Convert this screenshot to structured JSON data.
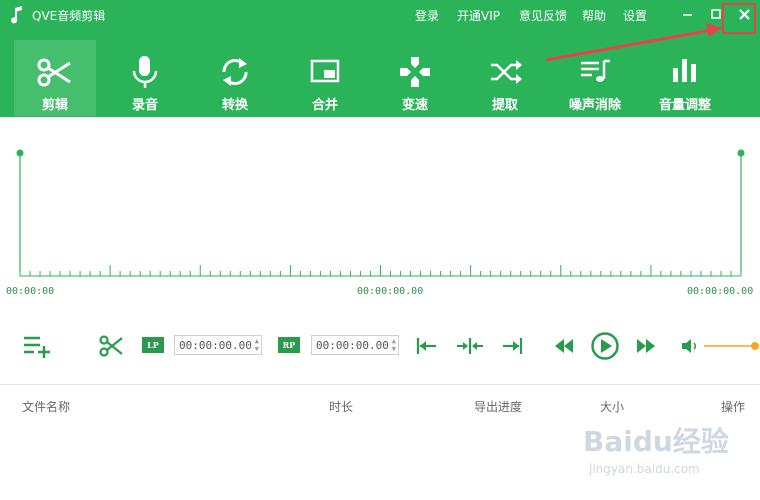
{
  "app": {
    "title": "QVE音频剪辑"
  },
  "menu": {
    "login": "登录",
    "vip": "开通VIP",
    "feedback": "意见反馈",
    "help": "帮助",
    "settings": "设置"
  },
  "tools": [
    {
      "label": "剪辑",
      "icon": "scissors-icon",
      "active": true
    },
    {
      "label": "录音",
      "icon": "microphone-icon",
      "active": false
    },
    {
      "label": "转换",
      "icon": "convert-icon",
      "active": false
    },
    {
      "label": "合并",
      "icon": "merge-icon",
      "active": false
    },
    {
      "label": "变速",
      "icon": "speed-icon",
      "active": false
    },
    {
      "label": "提取",
      "icon": "shuffle-icon",
      "active": false
    },
    {
      "label": "噪声消除",
      "icon": "noise-reduction-icon",
      "active": false
    },
    {
      "label": "音量调整",
      "icon": "volume-bars-icon",
      "active": false
    }
  ],
  "timeline": {
    "start": "00:00:00",
    "middle": "00:00:00.00",
    "end": "00:00:00.00"
  },
  "controls": {
    "lp_label": "LP",
    "rp_label": "RP",
    "lp_time": "00:00:00.00",
    "rp_time": "00:00:00.00"
  },
  "table": {
    "columns": [
      "文件名称",
      "时长",
      "导出进度",
      "大小",
      "操作"
    ]
  },
  "watermark": {
    "text": "Baidu经验",
    "url": "jingyan.baidu.com"
  },
  "colors": {
    "brand": "#2bb35a",
    "accent": "#f5a623",
    "highlight": "#e8424d"
  }
}
